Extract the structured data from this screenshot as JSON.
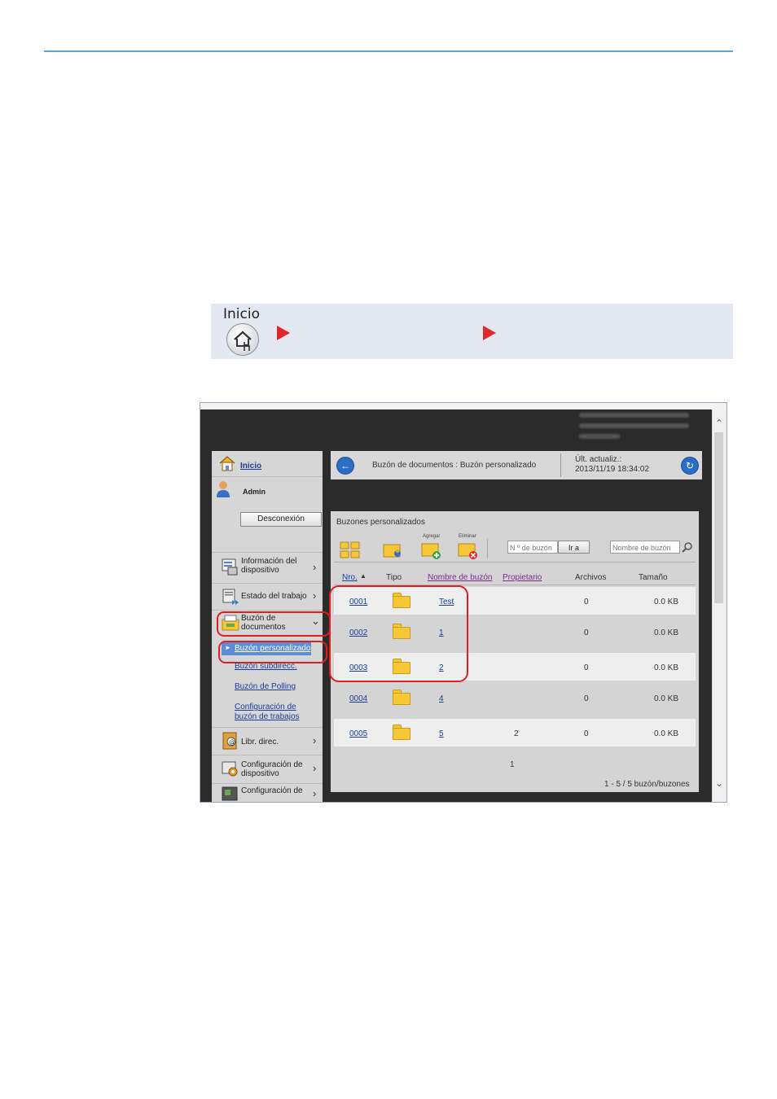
{
  "banner": {
    "label": "Inicio"
  },
  "sidebar": {
    "home_link": "Inicio",
    "user": "Admin",
    "logout_button": "Desconexión",
    "items": [
      {
        "label": "Información del dispositivo"
      },
      {
        "label": "Estado del trabajo"
      },
      {
        "label": "Buzón de documentos"
      },
      {
        "label": "Libr. direc."
      },
      {
        "label": "Configuración de dispositivo"
      },
      {
        "label": "Configuración de"
      }
    ],
    "subitems": [
      {
        "label": "Buzón personalizado"
      },
      {
        "label": "Buzón subdirecc."
      },
      {
        "label": "Buzón de Polling"
      },
      {
        "label": "Configuración de buzón de trabajos"
      }
    ]
  },
  "infobar": {
    "breadcrumb": "Buzón de documentos : Buzón personalizado",
    "updated_label": "Últ. actualiz.:",
    "updated_value": "2013/11/19 18:34:02"
  },
  "panel": {
    "title": "Buzones personalizados",
    "add_label": "Agregar",
    "delete_label": "Eliminar",
    "box_number_placeholder": "N º de buzón",
    "go_button": "Ir a",
    "box_name_placeholder": "Nombre de buzón",
    "columns": {
      "number": "Nro.",
      "type": "Tipo",
      "name": "Nombre de buzón",
      "owner": "Propietario",
      "files": "Archivos",
      "size": "Tamaño"
    },
    "rows": [
      {
        "number": "0001",
        "name": "Test",
        "owner": "",
        "files": "0",
        "size": "0.0 KB"
      },
      {
        "number": "0002",
        "name": "1",
        "owner": "",
        "files": "0",
        "size": "0.0 KB"
      },
      {
        "number": "0003",
        "name": "2",
        "owner": "",
        "files": "0",
        "size": "0.0 KB"
      },
      {
        "number": "0004",
        "name": "4",
        "owner": "",
        "files": "0",
        "size": "0.0 KB"
      },
      {
        "number": "0005",
        "name": "5",
        "owner": "2",
        "files": "0",
        "size": "0.0 KB"
      }
    ],
    "page": "1",
    "count_text": "1 - 5 / 5 buzón/buzones"
  },
  "colors": {
    "accent_red": "#e02020",
    "link": "#1a3d99",
    "selected": "#5b8ed6",
    "folder": "#f7c836"
  }
}
